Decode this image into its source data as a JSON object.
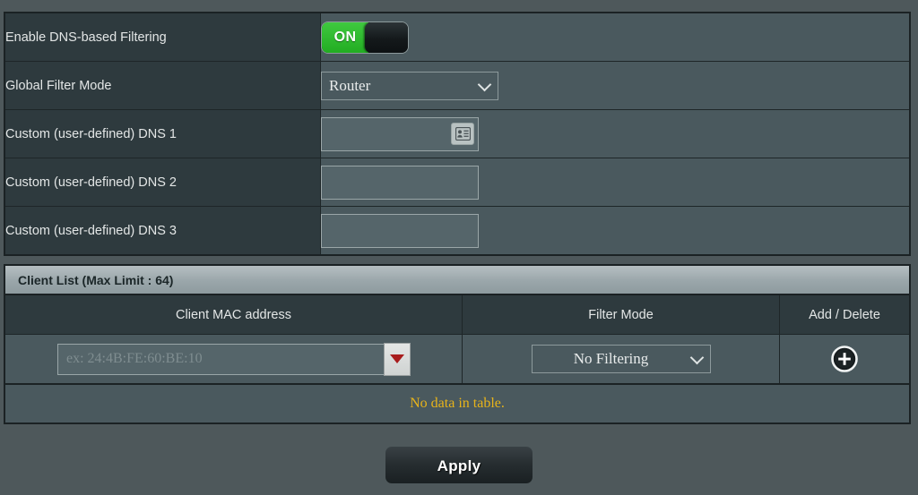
{
  "settings": {
    "rows": [
      {
        "label": "Enable DNS-based Filtering",
        "control": "toggle",
        "toggle_state": "ON"
      },
      {
        "label": "Global Filter Mode",
        "control": "select",
        "value": "Router"
      },
      {
        "label": "Custom (user-defined) DNS 1",
        "control": "text-with-icon",
        "value": "",
        "placeholder": ""
      },
      {
        "label": "Custom (user-defined) DNS 2",
        "control": "text",
        "value": "",
        "placeholder": ""
      },
      {
        "label": "Custom (user-defined) DNS 3",
        "control": "text",
        "value": "",
        "placeholder": ""
      }
    ]
  },
  "client_list": {
    "title": "Client List (Max Limit : 64)",
    "columns": [
      "Client MAC address",
      "Filter Mode",
      "Add / Delete"
    ],
    "entry_row": {
      "mac_value": "",
      "mac_placeholder": "ex: 24:4B:FE:60:BE:10",
      "filter_mode_value": "No Filtering",
      "add_icon": "plus-circle-icon"
    },
    "empty_message": "No data in table."
  },
  "footer": {
    "apply_label": "Apply"
  },
  "icons": {
    "contact_card": "contact-card-icon",
    "red_dropdown": "red-dropdown-triangle-icon",
    "chevron": "chevron-down-icon"
  },
  "colors": {
    "page_bg": "#4e585b",
    "label_cell_bg": "#2e3a3e",
    "value_cell_bg": "#4a595e",
    "toggle_on_green": "#2fba2f",
    "panel_header_gray": "#9aa6aa",
    "empty_text_amber": "#e8b41a",
    "red_triangle": "#a81d1d",
    "border_dark": "#1b2224"
  }
}
